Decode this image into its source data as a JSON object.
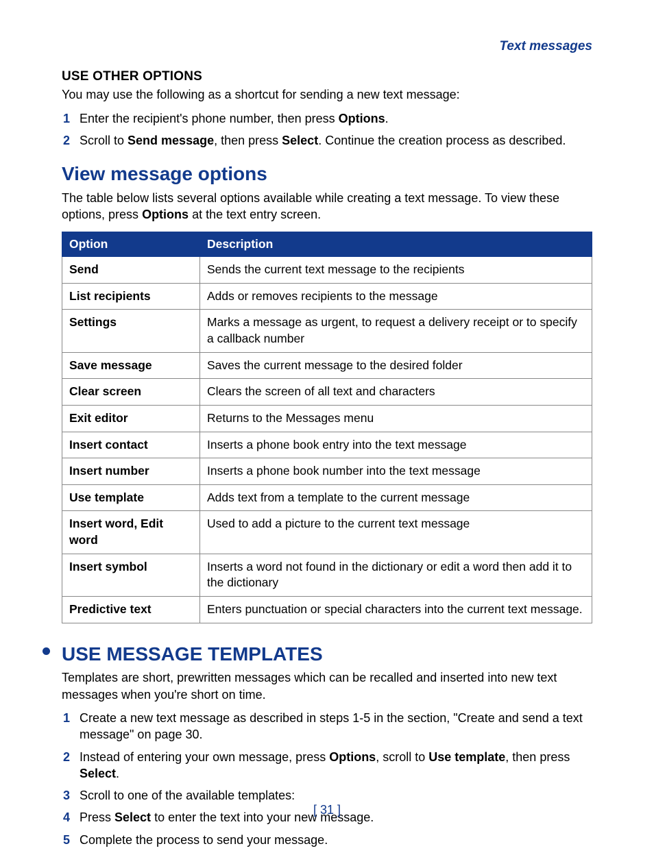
{
  "header": {
    "running_title": "Text messages"
  },
  "section_use_other": {
    "title": "USE OTHER OPTIONS",
    "intro": "You may use the following as a shortcut for sending a new text message:",
    "steps": [
      {
        "n": "1",
        "pre": "Enter the recipient's phone number, then press ",
        "b1": "Options",
        "post": "."
      },
      {
        "n": "2",
        "pre": "Scroll to ",
        "b1": "Send message",
        "mid": ", then press ",
        "b2": "Select",
        "post": ". Continue the creation process as described."
      }
    ]
  },
  "section_view_options": {
    "title": "View message options",
    "intro_pre": "The table below lists several options available while creating a text message. To view these options, press ",
    "intro_bold": "Options",
    "intro_post": " at the text entry screen.",
    "table": {
      "head_option": "Option",
      "head_desc": "Description",
      "rows": [
        {
          "option": "Send",
          "desc": "Sends the current text message to the recipients"
        },
        {
          "option": "List recipients",
          "desc": "Adds or removes recipients to the message"
        },
        {
          "option": "Settings",
          "desc": "Marks a message as urgent, to request a delivery receipt or to specify a callback number"
        },
        {
          "option": "Save message",
          "desc": "Saves the current message to the desired folder"
        },
        {
          "option": "Clear screen",
          "desc": "Clears the screen of all text and characters"
        },
        {
          "option": "Exit editor",
          "desc": "Returns to the Messages menu"
        },
        {
          "option": "Insert contact",
          "desc": "Inserts a phone book entry into the text message"
        },
        {
          "option": "Insert number",
          "desc": "Inserts a phone book number into the text message"
        },
        {
          "option": "Use template",
          "desc": "Adds text from a template to the current message"
        },
        {
          "option": "Insert word, Edit word",
          "desc": "Used to add a picture to the current text message"
        },
        {
          "option": "Insert symbol",
          "desc": "Inserts a word not found in the dictionary or edit a word then add it to the dictionary"
        },
        {
          "option": "Predictive text",
          "desc": "Enters punctuation or special characters into the current text message."
        }
      ]
    }
  },
  "section_templates": {
    "title": "USE MESSAGE TEMPLATES",
    "intro": "Templates are short, prewritten messages which can be recalled and inserted into new text messages when you're short on time.",
    "steps": [
      {
        "n": "1",
        "text": "Create a new text message as described in steps 1-5 in the section, \"Create and send a text message\" on page 30."
      },
      {
        "n": "2",
        "pre": "Instead of entering your own message, press ",
        "b1": "Options",
        "mid1": ", scroll to ",
        "b2": "Use template",
        "mid2": ", then press ",
        "b3": "Select",
        "post": "."
      },
      {
        "n": "3",
        "text": "Scroll to one of the available templates:"
      },
      {
        "n": "4",
        "pre": "Press ",
        "b1": "Select",
        "post": " to enter the text into your new message."
      },
      {
        "n": "5",
        "text": "Complete the process to send your message."
      }
    ]
  },
  "footer": {
    "page_number": "[ 31 ]"
  }
}
